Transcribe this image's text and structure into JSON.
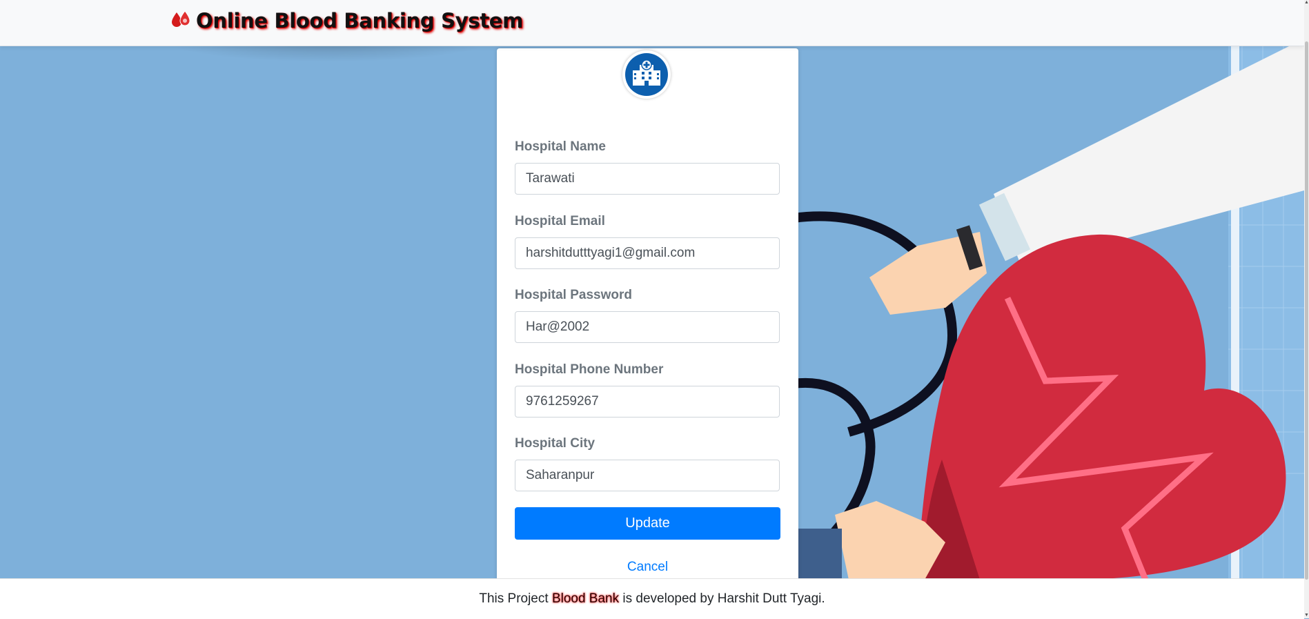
{
  "header": {
    "title": "Online Blood Banking System",
    "logo_icon": "blood-drops-icon",
    "accent_color": "#d00000"
  },
  "form": {
    "avatar_icon": "hospital-building-icon",
    "fields": [
      {
        "label": "Hospital Name",
        "value": "Tarawati"
      },
      {
        "label": "Hospital Email",
        "value": "harshitdutttyagi1@gmail.com"
      },
      {
        "label": "Hospital Password",
        "value": "Har@2002"
      },
      {
        "label": "Hospital Phone Number",
        "value": "9761259267"
      },
      {
        "label": "Hospital City",
        "value": "Saharanpur"
      }
    ],
    "update_label": "Update",
    "cancel_label": "Cancel",
    "button_color": "#007bff"
  },
  "footer": {
    "prefix": "This Project ",
    "highlight": "Blood Bank",
    "suffix": " is developed by Harshit Dutt Tyagi."
  }
}
